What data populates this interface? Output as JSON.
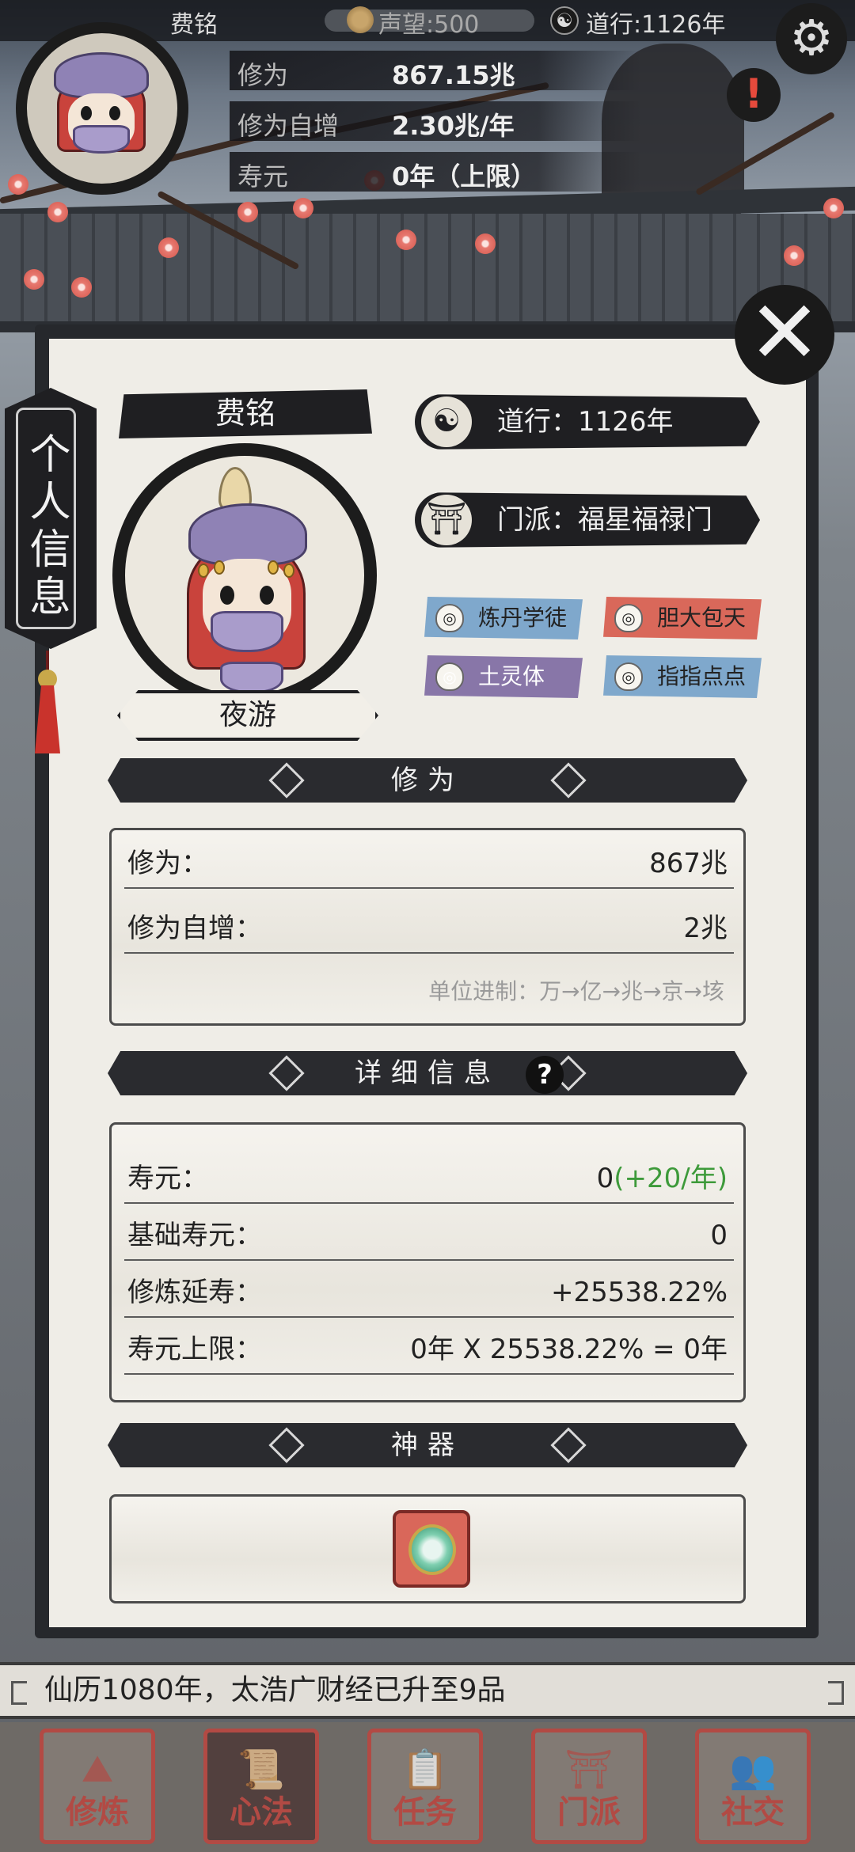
{
  "topbar": {
    "player_name": "费铭",
    "fame": "声望:500",
    "tao_icon": "☯",
    "daoxing": "道行:1126年"
  },
  "header": {
    "stats": [
      {
        "label": "修为",
        "value": "867.15兆"
      },
      {
        "label": "修为自增",
        "value": "2.30兆/年"
      },
      {
        "label": "寿元",
        "value": "0年（上限）"
      }
    ],
    "settings_icon": "gear-icon",
    "alert_icon": "!"
  },
  "side_tab": {
    "label": "个人信息"
  },
  "profile": {
    "name": "费铭",
    "title": "夜游",
    "daoxing": "道行：1126年",
    "sect": "门派：福星福禄门",
    "traits": [
      {
        "label": "炼丹学徒",
        "color": "#7fa8cc"
      },
      {
        "label": "胆大包天",
        "color": "#d9685a"
      },
      {
        "label": "土灵体",
        "color": "#8876a8"
      },
      {
        "label": "指指点点",
        "color": "#7fa8cc"
      }
    ]
  },
  "cultivation": {
    "section_title": "修为",
    "rows": [
      {
        "k": "修为：",
        "v": "867兆"
      },
      {
        "k": "修为自增：",
        "v": "2兆"
      }
    ],
    "unit_note": "单位进制：万→亿→兆→京→垓"
  },
  "details": {
    "section_title": "详细信息",
    "help": "?",
    "lifespan_label": "寿元：",
    "lifespan_value": "0",
    "lifespan_gain": "(+20/年)",
    "rows": [
      {
        "k": "基础寿元：",
        "v": "0"
      },
      {
        "k": "修炼延寿：",
        "v": "+25538.22%"
      },
      {
        "k": "寿元上限：",
        "v": "0年 X 25538.22% = 0年"
      }
    ]
  },
  "artifact": {
    "section_title": "神器",
    "item_icon": "jade-mirror-icon"
  },
  "ticker": {
    "text": "仙历1080年，太浩广财经已升至9品"
  },
  "nav": [
    {
      "label": "修炼",
      "glyph": "⛰"
    },
    {
      "label": "心法",
      "glyph": "📜",
      "active": true
    },
    {
      "label": "任务",
      "glyph": "📋"
    },
    {
      "label": "门派",
      "glyph": "⛩"
    },
    {
      "label": "社交",
      "glyph": "👥"
    }
  ],
  "colors": {
    "accent_red": "#b24a44",
    "green": "#3d9a3a",
    "ink": "#1f1f22"
  }
}
